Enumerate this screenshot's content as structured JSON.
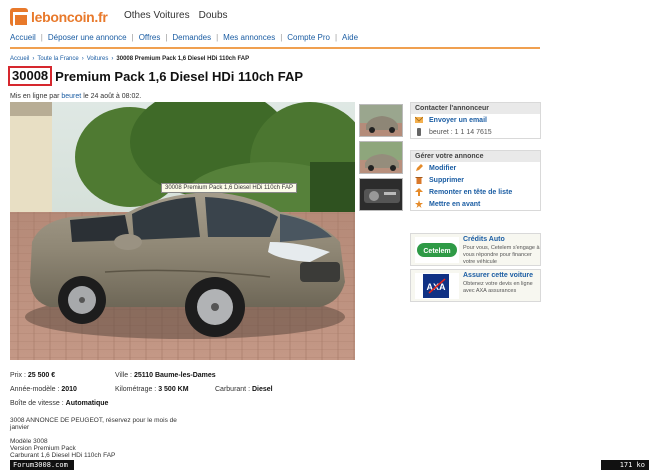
{
  "header": {
    "logo_name": "leboncoin",
    "logo_tld": ".fr",
    "links": [
      "Othes Voitures",
      "Doubs"
    ]
  },
  "nav": {
    "items": [
      "Accueil",
      "Déposer une annonce",
      "Offres",
      "Demandes",
      "Mes annonces",
      "Compte Pro",
      "Aide"
    ]
  },
  "breadcrumb": {
    "items": [
      "Accueil",
      "Toute la France",
      "Voitures"
    ],
    "current": "30008 Premium Pack 1,6 Diesel HDi 110ch FAP"
  },
  "listing": {
    "title_model": "30008",
    "title_rest": "Premium Pack 1,6 Diesel HDi 110ch FAP",
    "online_prefix": "Mis en ligne par",
    "online_user": "beuret",
    "online_suffix": "le 24 août à 08:02.",
    "photo_tooltip": "30008 Premium Pack 1,6 Diesel HDi 110ch FAP"
  },
  "contact_panel": {
    "heading": "Contacter l'annonceur",
    "email": "Envoyer un email",
    "phone": "beuret : 1 1 14 7615"
  },
  "manage_panel": {
    "heading": "Gérer votre annonce",
    "items": [
      "Modifier",
      "Supprimer",
      "Remonter en tête de liste",
      "Mettre en avant"
    ]
  },
  "ads": [
    {
      "logo": "Cetelem",
      "title": "Crédits Auto",
      "text": "Pour vous, Cetelem s'engage à vous répondre pour financer votre véhicule"
    },
    {
      "logo": "AXA",
      "title": "Assurer cette voiture",
      "text": "Obtenez votre devis en ligne avec AXA assurances"
    }
  ],
  "details": {
    "price_label": "Prix :",
    "price": "25 500 €",
    "city_label": "Ville :",
    "city": "25110 Baume-les-Dames",
    "year_label": "Année-modèle :",
    "year": "2010",
    "km_label": "Kilométrage :",
    "km": "3 500 KM",
    "fuel_label": "Carburant :",
    "fuel": "Diesel",
    "gearbox_label": "Boîte de vitesse :",
    "gearbox": "Automatique"
  },
  "description": {
    "line1": "3008 ANNONCE DE PEUGEOT, réservez pour le mois de",
    "line2": "janvier",
    "line3": "Modèle 3008",
    "line4": "Version Premium Pack",
    "line5": "Carburant 1,6 Diesel HDi 110ch FAP"
  },
  "watermark": {
    "forum": "Forum3008.com",
    "size": "171 ko"
  },
  "colors": {
    "brand_orange": "#e8792b",
    "link_blue": "#1b5da3",
    "highlight_red": "#d6282e"
  }
}
